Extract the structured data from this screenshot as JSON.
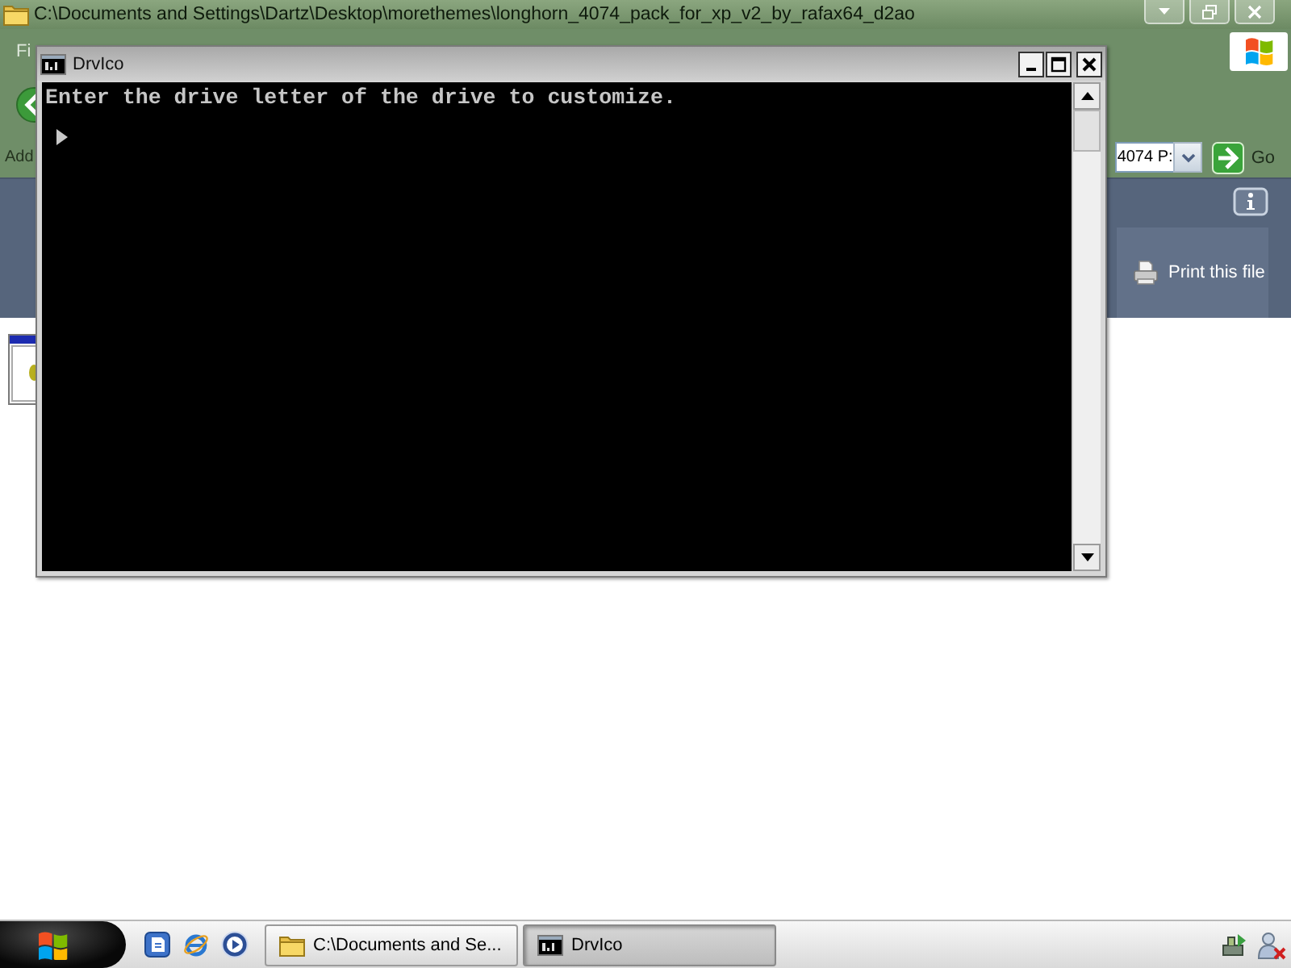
{
  "explorer": {
    "title": "C:\\Documents and Settings\\Dartz\\Desktop\\morethemes\\longhorn_4074_pack_for_xp_v2_by_rafax64_d2ao",
    "menu": [
      "Fi"
    ],
    "address": {
      "label": "Add",
      "value": "4074 P:",
      "go_label": "Go"
    },
    "task_links": [
      "Print this file"
    ]
  },
  "console": {
    "title": "DrvIco",
    "lines": [
      "Enter the drive letter of the drive to customize."
    ]
  },
  "taskbar": {
    "tasks": [
      {
        "kind": "folder",
        "label": "C:\\Documents and Se...",
        "selected": false
      },
      {
        "kind": "console",
        "label": "DrvIco",
        "selected": true
      }
    ]
  }
}
